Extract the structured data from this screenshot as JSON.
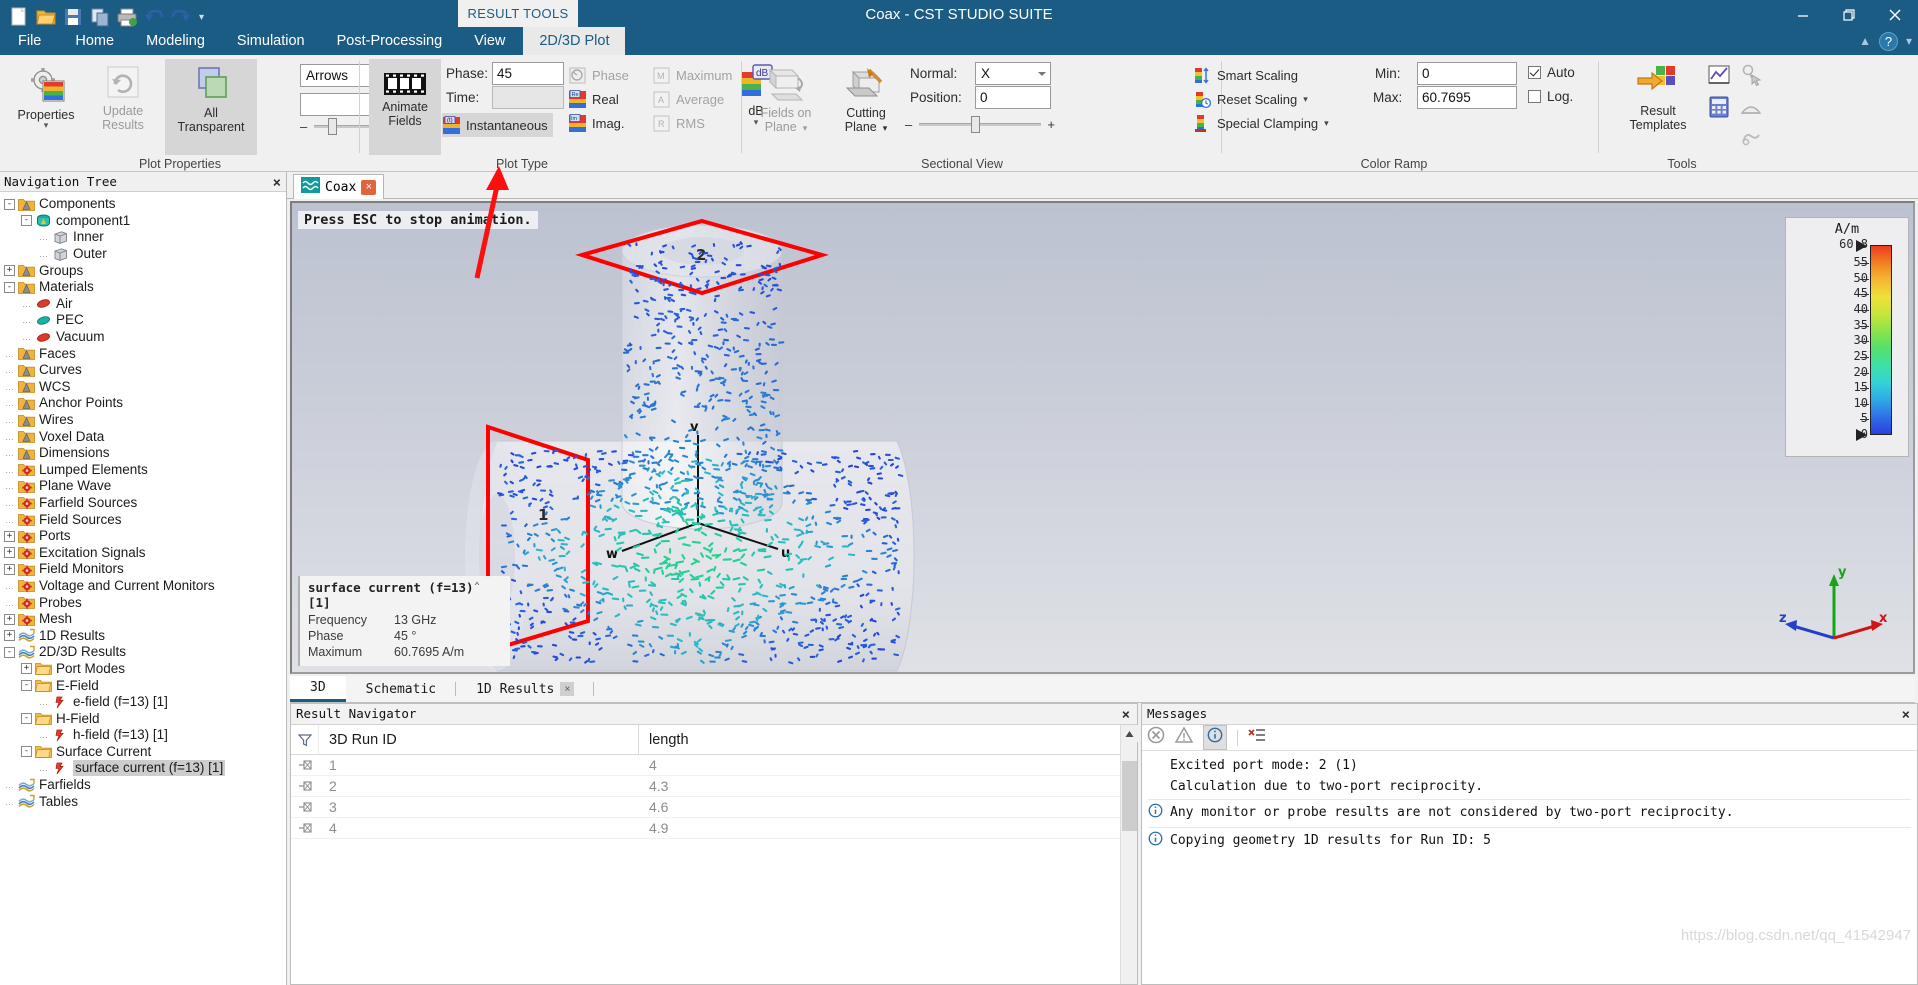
{
  "window": {
    "title": "Coax - CST STUDIO SUITE",
    "minimize_label": "minimize-icon",
    "restore_label": "restore-icon",
    "close_label": "close-icon"
  },
  "quick_access": {
    "items": [
      {
        "name": "new-icon",
        "label": "New"
      },
      {
        "name": "open-icon",
        "label": "Open"
      },
      {
        "name": "save-icon",
        "label": "Save"
      },
      {
        "name": "copy-icon",
        "label": "Copy"
      },
      {
        "name": "print-icon",
        "label": "Print"
      },
      {
        "name": "undo-icon",
        "label": "Undo"
      },
      {
        "name": "redo-icon",
        "label": "Redo"
      },
      {
        "name": "customize-icon",
        "label": "Customize Quick Access Toolbar"
      }
    ]
  },
  "ribbon": {
    "context_tab_group": "RESULT TOOLS",
    "tabs": [
      {
        "label": "File",
        "active": false
      },
      {
        "label": "Home",
        "active": false
      },
      {
        "label": "Modeling",
        "active": false
      },
      {
        "label": "Simulation",
        "active": false
      },
      {
        "label": "Post-Processing",
        "active": false
      },
      {
        "label": "View",
        "active": false
      },
      {
        "label": "2D/3D Plot",
        "active": true
      }
    ],
    "help_label": "?",
    "collapse_label": "collapse-ribbon",
    "groups": {
      "plot_properties": {
        "title": "Plot Properties",
        "properties_label": "Properties",
        "update_results_label": "Update\nResults",
        "update_results_line1": "Update",
        "update_results_line2": "Results",
        "all_transparent_line1": "All",
        "all_transparent_line2": "Transparent",
        "plot_type_combo": "Arrows",
        "plot_subtype_combo": "",
        "slider_minus": "–",
        "slider_plus": "+"
      },
      "plot_type": {
        "title": "Plot Type",
        "animate_line1": "Animate",
        "animate_line2": "Fields",
        "phase_label": "Phase:",
        "phase_value": "45",
        "time_label": "Time:",
        "time_value": "",
        "instantaneous_label": "Instantaneous",
        "phase_option": "Phase",
        "real_option": "Real",
        "imag_option": "Imag.",
        "maximum_option": "Maximum",
        "average_option": "Average",
        "rms_option": "RMS",
        "db_label": "dB"
      },
      "sectional_view": {
        "title": "Sectional View",
        "fields_on_plane_line1": "Fields on",
        "fields_on_plane_line2": "Plane",
        "cutting_plane_line1": "Cutting",
        "cutting_plane_line2": "Plane",
        "normal_label": "Normal:",
        "normal_value": "X",
        "position_label": "Position:",
        "position_value": "0",
        "slider_minus": "–",
        "slider_plus": "+"
      },
      "color_ramp": {
        "title": "Color Ramp",
        "smart_scaling": "Smart Scaling",
        "reset_scaling": "Reset Scaling",
        "special_clamping": "Special Clamping",
        "min_label": "Min:",
        "min_value": "0",
        "max_label": "Max:",
        "max_value": "60.7695",
        "auto_label": "Auto",
        "auto_checked": true,
        "log_label": "Log.",
        "log_checked": false
      },
      "tools": {
        "title": "Tools",
        "result_templates_line1": "Result",
        "result_templates_line2": "Templates",
        "icons": [
          {
            "name": "curve-chart-icon"
          },
          {
            "name": "calculator-icon"
          },
          {
            "name": "pick-point-icon"
          },
          {
            "name": "measure-icon"
          },
          {
            "name": "macro-icon"
          }
        ]
      }
    }
  },
  "navigation": {
    "title": "Navigation Tree",
    "close_label": "×",
    "items": [
      {
        "label": "Components",
        "depth": 0,
        "expander": "-",
        "icon": "folder-cone",
        "selected": false
      },
      {
        "label": "component1",
        "depth": 1,
        "expander": "-",
        "icon": "component",
        "selected": false
      },
      {
        "label": "Inner",
        "depth": 2,
        "expander": "",
        "icon": "solid",
        "selected": false
      },
      {
        "label": "Outer",
        "depth": 2,
        "expander": "",
        "icon": "solid",
        "selected": false
      },
      {
        "label": "Groups",
        "depth": 0,
        "expander": "+",
        "icon": "folder-cone",
        "selected": false
      },
      {
        "label": "Materials",
        "depth": 0,
        "expander": "-",
        "icon": "folder-cone",
        "selected": false
      },
      {
        "label": "Air",
        "depth": 1,
        "expander": "",
        "icon": "mat-red",
        "selected": false
      },
      {
        "label": "PEC",
        "depth": 1,
        "expander": "",
        "icon": "mat-teal",
        "selected": false
      },
      {
        "label": "Vacuum",
        "depth": 1,
        "expander": "",
        "icon": "mat-red",
        "selected": false
      },
      {
        "label": "Faces",
        "depth": 0,
        "expander": "",
        "icon": "folder-cone",
        "selected": false
      },
      {
        "label": "Curves",
        "depth": 0,
        "expander": "",
        "icon": "folder-cone",
        "selected": false
      },
      {
        "label": "WCS",
        "depth": 0,
        "expander": "",
        "icon": "folder-cone",
        "selected": false
      },
      {
        "label": "Anchor Points",
        "depth": 0,
        "expander": "",
        "icon": "folder-cone",
        "selected": false
      },
      {
        "label": "Wires",
        "depth": 0,
        "expander": "",
        "icon": "folder-cone",
        "selected": false
      },
      {
        "label": "Voxel Data",
        "depth": 0,
        "expander": "",
        "icon": "folder-cone",
        "selected": false
      },
      {
        "label": "Dimensions",
        "depth": 0,
        "expander": "",
        "icon": "folder-cone",
        "selected": false
      },
      {
        "label": "Lumped Elements",
        "depth": 0,
        "expander": "",
        "icon": "folder-gear",
        "selected": false
      },
      {
        "label": "Plane Wave",
        "depth": 0,
        "expander": "",
        "icon": "folder-gear",
        "selected": false
      },
      {
        "label": "Farfield Sources",
        "depth": 0,
        "expander": "",
        "icon": "folder-gear",
        "selected": false
      },
      {
        "label": "Field Sources",
        "depth": 0,
        "expander": "",
        "icon": "folder-gear",
        "selected": false
      },
      {
        "label": "Ports",
        "depth": 0,
        "expander": "+",
        "icon": "folder-gear",
        "selected": false
      },
      {
        "label": "Excitation Signals",
        "depth": 0,
        "expander": "+",
        "icon": "folder-gear",
        "selected": false
      },
      {
        "label": "Field Monitors",
        "depth": 0,
        "expander": "+",
        "icon": "folder-gear",
        "selected": false
      },
      {
        "label": "Voltage and Current Monitors",
        "depth": 0,
        "expander": "",
        "icon": "folder-gear",
        "selected": false
      },
      {
        "label": "Probes",
        "depth": 0,
        "expander": "",
        "icon": "folder-gear",
        "selected": false
      },
      {
        "label": "Mesh",
        "depth": 0,
        "expander": "+",
        "icon": "folder-gear",
        "selected": false
      },
      {
        "label": "1D Results",
        "depth": 0,
        "expander": "+",
        "icon": "results",
        "selected": false
      },
      {
        "label": "2D/3D Results",
        "depth": 0,
        "expander": "-",
        "icon": "results",
        "selected": false
      },
      {
        "label": "Port Modes",
        "depth": 1,
        "expander": "+",
        "icon": "folder-plain",
        "selected": false
      },
      {
        "label": "E-Field",
        "depth": 1,
        "expander": "-",
        "icon": "folder-plain",
        "selected": false
      },
      {
        "label": "e-field (f=13) [1]",
        "depth": 2,
        "expander": "",
        "icon": "field",
        "selected": false
      },
      {
        "label": "H-Field",
        "depth": 1,
        "expander": "-",
        "icon": "folder-plain",
        "selected": false
      },
      {
        "label": "h-field (f=13) [1]",
        "depth": 2,
        "expander": "",
        "icon": "field",
        "selected": false
      },
      {
        "label": "Surface Current",
        "depth": 1,
        "expander": "-",
        "icon": "folder-plain",
        "selected": false
      },
      {
        "label": "surface current (f=13) [1]",
        "depth": 2,
        "expander": "",
        "icon": "field",
        "selected": true
      },
      {
        "label": "Farfields",
        "depth": 0,
        "expander": "",
        "icon": "results",
        "selected": false
      },
      {
        "label": "Tables",
        "depth": 0,
        "expander": "",
        "icon": "results",
        "selected": false
      }
    ]
  },
  "document_tabs": [
    {
      "label": "Coax",
      "icon": "wave-icon",
      "close": "×",
      "active": true
    }
  ],
  "viewport": {
    "status_message": "Press ESC to stop animation.",
    "port_labels": [
      "1",
      "2"
    ],
    "axis_labels": {
      "u": "u",
      "v": "v",
      "w": "w",
      "x": "x",
      "y": "y",
      "z": "z"
    },
    "info": {
      "title": "surface current (f=13) [1]",
      "collapse_caret": "⌃",
      "rows": [
        {
          "key": "Frequency",
          "value": "13 GHz"
        },
        {
          "key": "Phase",
          "value": "45 °"
        },
        {
          "key": "Maximum",
          "value": "60.7695 A/m"
        }
      ]
    },
    "legend": {
      "unit": "A/m",
      "max_label": "60.8",
      "min_label": "0",
      "ticks": [
        "55",
        "50",
        "45",
        "40",
        "35",
        "30",
        "25",
        "20",
        "15",
        "10",
        "5"
      ]
    }
  },
  "chart_data": {
    "type": "heatmap",
    "title": "surface current (f=13) [1]",
    "ylabel": "A/m",
    "colorbar_min": 0,
    "colorbar_max": 60.8,
    "colorbar_ticks": [
      0,
      5,
      10,
      15,
      20,
      25,
      30,
      35,
      40,
      45,
      50,
      55,
      60.8
    ],
    "frequency_ghz": 13,
    "phase_deg": 45,
    "maximum": 60.7695
  },
  "bottom_tabs": [
    {
      "label": "3D",
      "active": true,
      "closable": false
    },
    {
      "label": "Schematic",
      "active": false,
      "closable": false
    },
    {
      "label": "1D Results",
      "active": false,
      "closable": true,
      "close": "×"
    }
  ],
  "result_navigator": {
    "title": "Result Navigator",
    "close_label": "×",
    "filter_icon": "filter-icon",
    "columns": [
      "3D Run ID",
      "length"
    ],
    "rows": [
      {
        "run_id": "1",
        "length": "4"
      },
      {
        "run_id": "2",
        "length": "4.3"
      },
      {
        "run_id": "3",
        "length": "4.6"
      },
      {
        "run_id": "4",
        "length": "4.9"
      }
    ]
  },
  "messages": {
    "title": "Messages",
    "close_label": "×",
    "toolbar": [
      {
        "name": "error-filter-icon",
        "label": "Errors"
      },
      {
        "name": "warning-filter-icon",
        "label": "Warnings"
      },
      {
        "name": "info-filter-icon",
        "label": "Information"
      },
      {
        "name": "clear-messages-icon",
        "label": "Clear"
      }
    ],
    "lines": [
      {
        "icon": "",
        "text": "Excited port mode: 2 (1)"
      },
      {
        "icon": "",
        "text": "Calculation due to two-port reciprocity."
      },
      {
        "icon": "info",
        "text": "Any monitor or probe results are not considered by two-port reciprocity."
      },
      {
        "icon": "info",
        "text": "Copying geometry 1D results for Run ID: 5"
      }
    ],
    "watermark": "https://blog.csdn.net/qq_41542947"
  }
}
